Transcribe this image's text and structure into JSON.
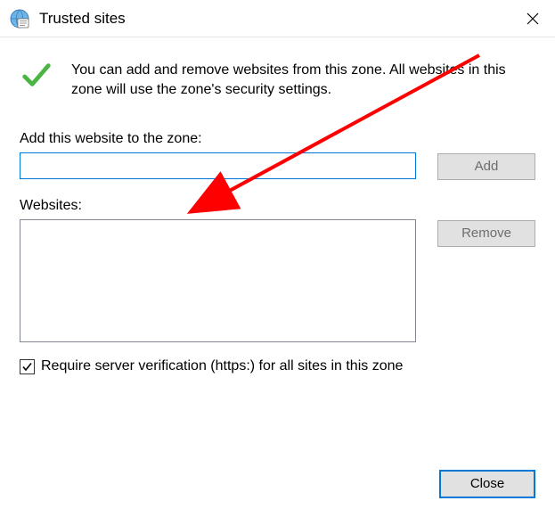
{
  "window": {
    "title": "Trusted sites"
  },
  "info": {
    "text": "You can add and remove websites from this zone. All websites in this zone will use the zone's security settings."
  },
  "labels": {
    "add_website": "Add this website to the zone:",
    "websites": "Websites:",
    "require_https": "Require server verification (https:) for all sites in this zone"
  },
  "inputs": {
    "add_value": ""
  },
  "buttons": {
    "add": "Add",
    "remove": "Remove",
    "close": "Close"
  },
  "checkbox": {
    "require_https_checked": true
  },
  "annotation": {
    "arrow_color": "#ff0000"
  }
}
